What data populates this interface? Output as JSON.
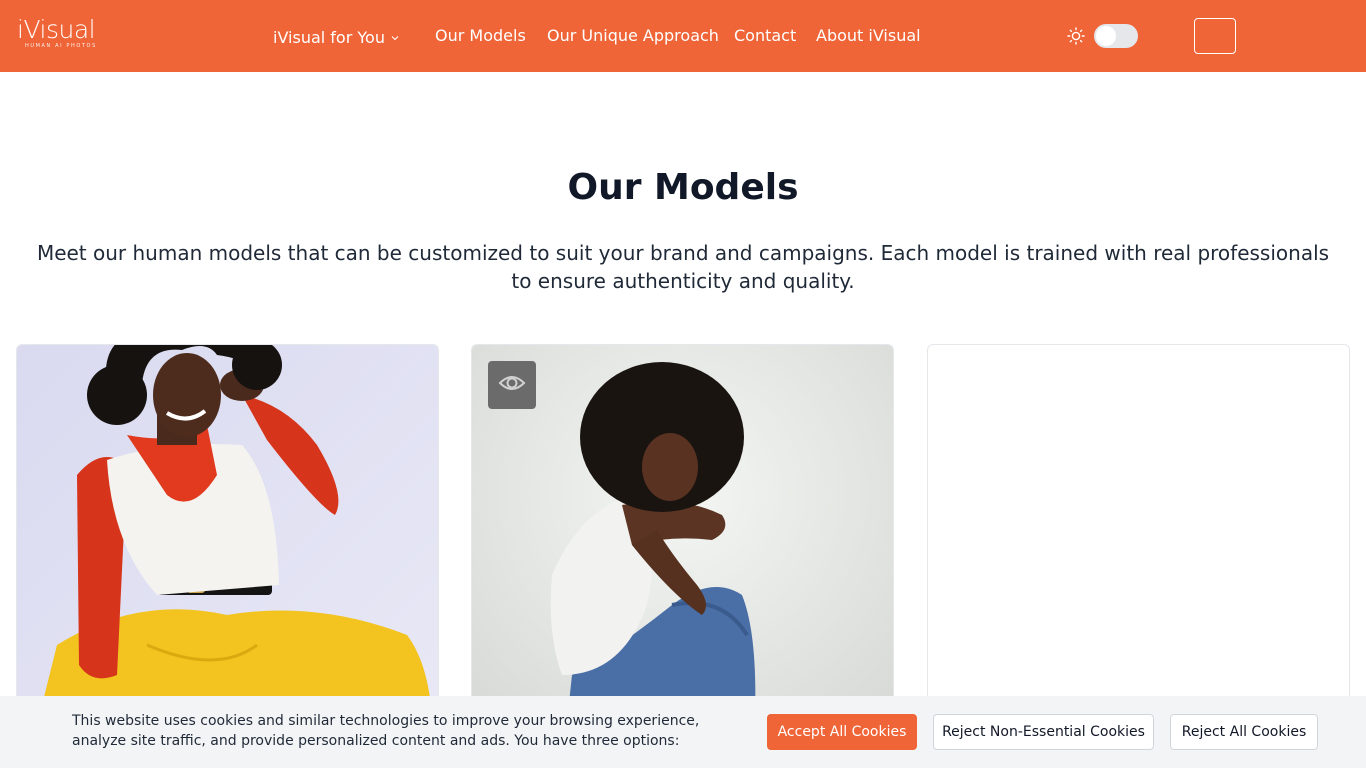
{
  "header": {
    "logo_text": "iVisual",
    "logo_tagline": "HUMAN AI PHOTOS",
    "nav": {
      "for_you": "iVisual for You",
      "models": "Our Models",
      "approach": "Our Unique Approach",
      "contact": "Contact",
      "about": "About iVisual"
    },
    "theme_toggle_on": false
  },
  "main": {
    "title": "Our Models",
    "intro": "Meet our human models that can be customized to suit your brand and campaigns. Each model is trained with real professionals to ensure authenticity and quality."
  },
  "cookie": {
    "text": "This website uses cookies and similar technologies to improve your browsing experience, analyze site traffic, and provide personalized content and ads. You have three options:",
    "accept": "Accept All Cookies",
    "reject_non_essential": "Reject Non-Essential Cookies",
    "reject_all": "Reject All Cookies"
  },
  "colors": {
    "brand": "#ef6537",
    "text_dark": "#111827",
    "banner_bg": "#f3f4f6"
  },
  "icons": [
    "sun-icon",
    "chevron-down-icon",
    "eye-icon",
    "menu-icon"
  ]
}
